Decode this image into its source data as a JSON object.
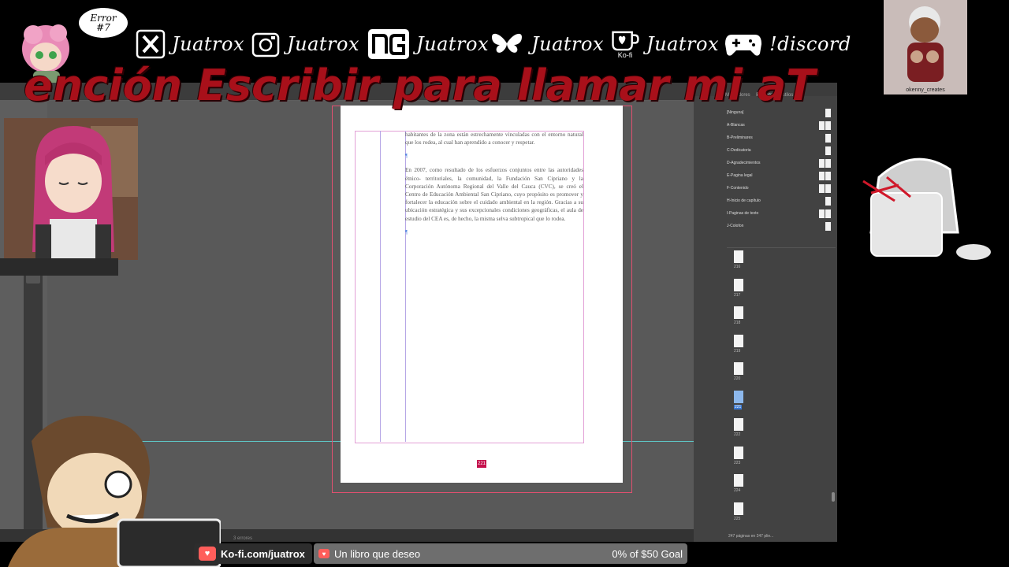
{
  "overlay": {
    "error_bubble": {
      "line1": "Error",
      "line2": "#7"
    },
    "socials": [
      {
        "icon": "x-logo-icon",
        "handle": "Juatrox"
      },
      {
        "icon": "instagram-icon",
        "handle": "Juatrox"
      },
      {
        "icon": "newgrounds-icon",
        "handle": "Juatrox"
      },
      {
        "icon": "bluesky-butterfly-icon",
        "handle": "Juatrox"
      },
      {
        "icon": "kofi-cup-icon",
        "handle": "Juatrox",
        "icon_caption": "Ko-fi"
      },
      {
        "icon": "gamepad-icon",
        "handle": "!discord"
      }
    ],
    "scrolling_banner": "ención Escribir para llamar mi aT",
    "art_card_credit": "okenny_creates"
  },
  "indesign": {
    "text_frame": {
      "paragraphs": [
        "habitantes de la zona están estrechamente vinculadas con el entorno natural que los rodea, al cual han aprendido a conocer y respetar.",
        "En 2007, como resultado de los esfuerzos conjuntos entre las autoridades étnico- territoriales, la comunidad, la Fundación San Cipriano y la Corporación Autónoma Regional del Valle del Cauca (CVC), se creó el Centro de Educación Ambiental San Cipriano, cuyo propósito es promover y fortalecer la educación sobre el cuidado ambiental en la región. Gracias a su ubicación estratégica y sus excepcionales condiciones geográficas, el aula de estudio del CEA es, de hecho, la misma selva subtropical que lo rodea."
      ],
      "para_marks": [
        "¶",
        "¶",
        "¶"
      ]
    },
    "current_page_marker": "221",
    "status_text": "3 errores",
    "panel": {
      "tabs": [
        "Marcadores",
        "Páginas",
        "Estilos"
      ],
      "parents": [
        {
          "label": "[Ninguna]",
          "thumbs": 1
        },
        {
          "label": "A-Blancas",
          "thumbs": 2
        },
        {
          "label": "B-Preliminares",
          "thumbs": 1
        },
        {
          "label": "C-Dedicatoria",
          "thumbs": 1
        },
        {
          "label": "D-Agradecimientos",
          "thumbs": 2
        },
        {
          "label": "E-Pagina legal",
          "thumbs": 2
        },
        {
          "label": "F-Contenido",
          "thumbs": 2
        },
        {
          "label": "H-Inicio de capítulo",
          "thumbs": 1
        },
        {
          "label": "I-Paginas de texto",
          "thumbs": 2
        },
        {
          "label": "J-Colofon",
          "thumbs": 1
        }
      ],
      "pages": [
        {
          "num": "216",
          "selected": false
        },
        {
          "num": "217",
          "selected": false
        },
        {
          "num": "218",
          "selected": false
        },
        {
          "num": "219",
          "selected": false
        },
        {
          "num": "220",
          "selected": false
        },
        {
          "num": "221",
          "selected": true
        },
        {
          "num": "222",
          "selected": false
        },
        {
          "num": "223",
          "selected": false
        },
        {
          "num": "224",
          "selected": false
        },
        {
          "num": "225",
          "selected": false
        }
      ],
      "footer": "247 páginas en 247 plie..."
    }
  },
  "bottom_bar": {
    "kofi_link": "Ko-fi.com/juatrox",
    "goal_label": "Un libro que deseo",
    "goal_progress": "0% of $50 Goal"
  },
  "colors": {
    "banner_red": "#a8101a",
    "kofi_red": "#ff5e5b",
    "page_marker": "#c4104c",
    "selected_page": "#3b78d0"
  }
}
